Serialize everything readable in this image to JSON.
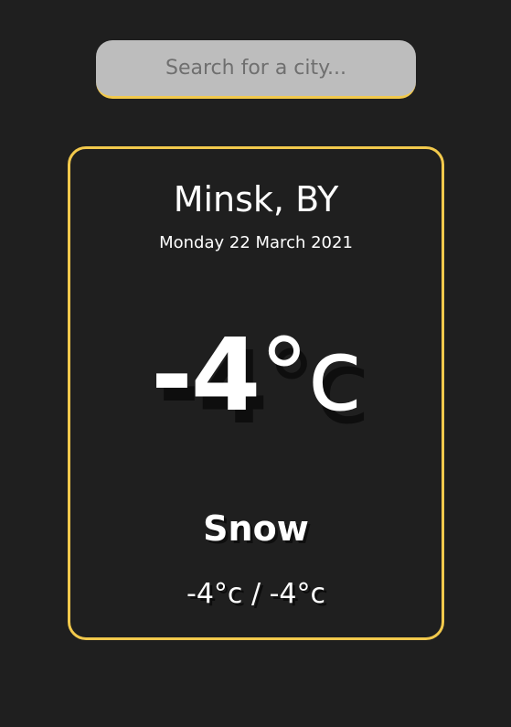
{
  "search": {
    "placeholder": "Search for a city...",
    "value": ""
  },
  "weather": {
    "location": "Minsk, BY",
    "date": "Monday 22 March 2021",
    "temperature": "-4",
    "temperature_unit": "°c",
    "condition": "Snow",
    "min_max": "-4°c / -4°c"
  },
  "colors": {
    "background": "#1f1f1f",
    "accent": "#f2c94c",
    "search_background": "#bdbdbd",
    "text": "#ffffff"
  }
}
